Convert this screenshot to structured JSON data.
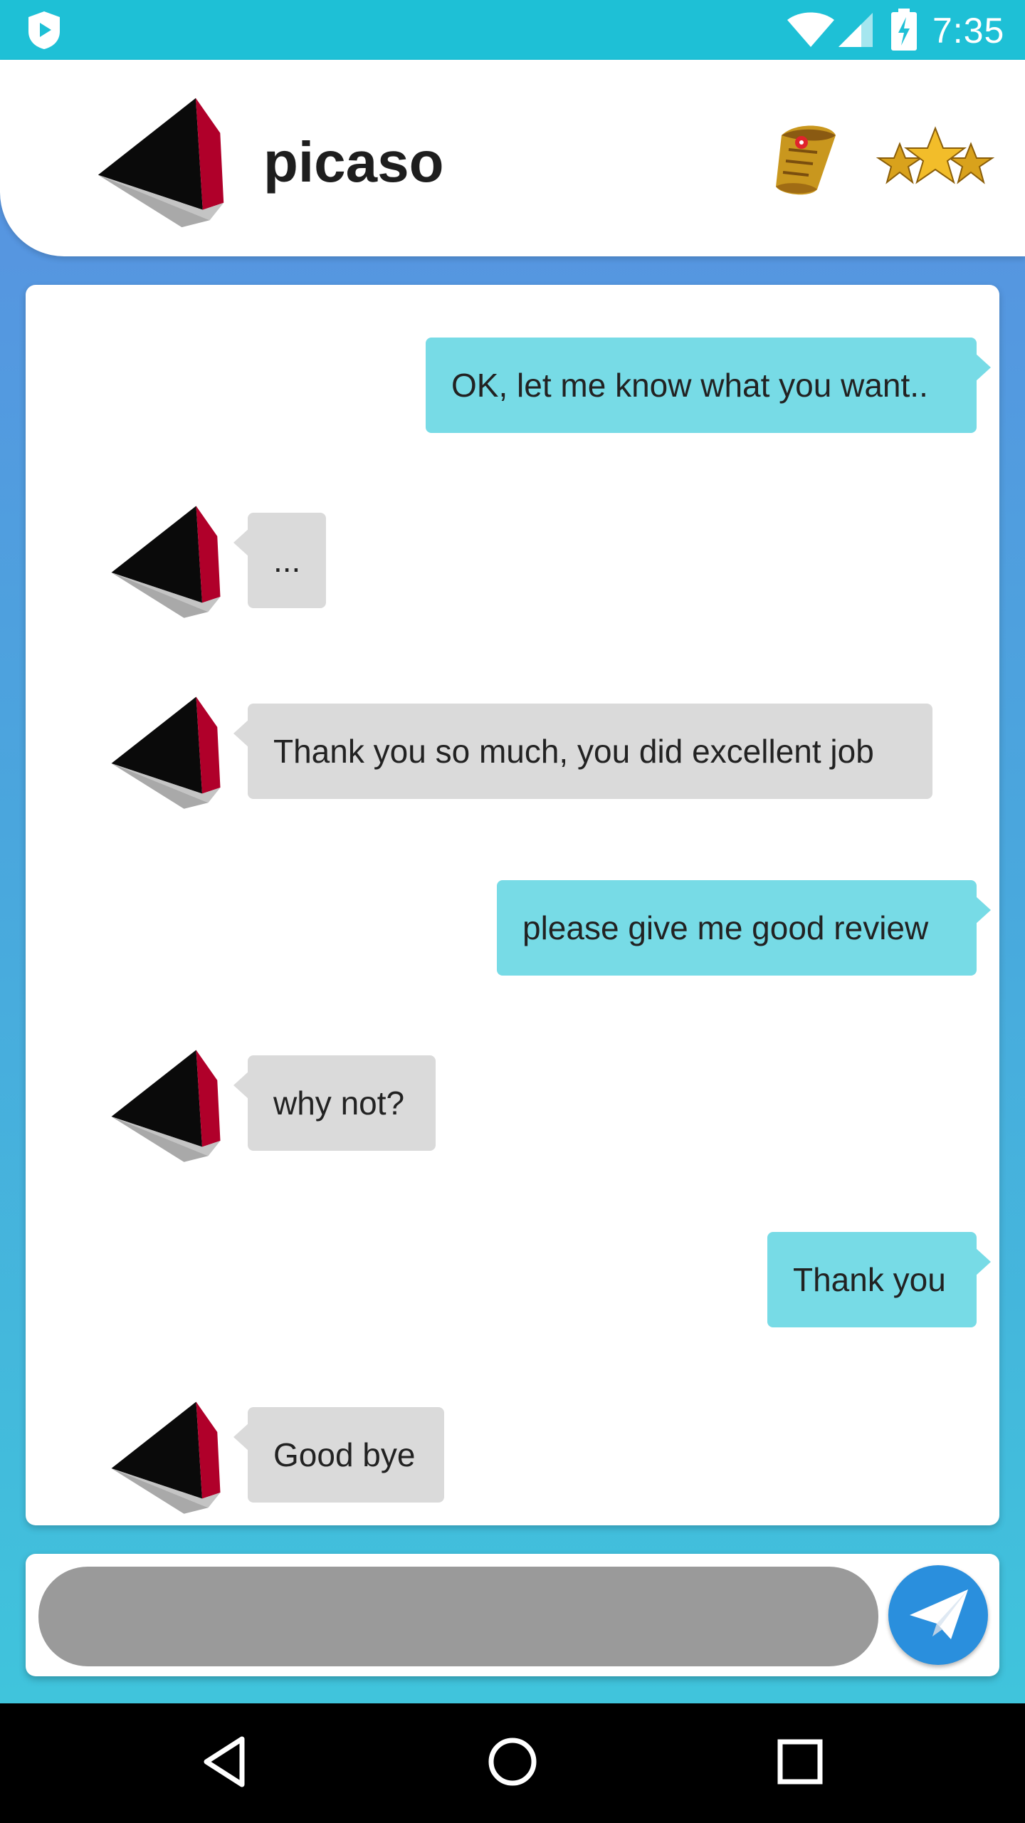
{
  "status_bar": {
    "time": "7:35",
    "icons": [
      "shield-icon",
      "wifi-icon",
      "signal-icon",
      "battery-charging-icon"
    ]
  },
  "header": {
    "title": "picaso",
    "icons": [
      "avatar-pyramid-icon",
      "scroll-map-icon",
      "three-stars-icon"
    ]
  },
  "messages": [
    {
      "sender": "me",
      "text": "OK, let me know what you want.."
    },
    {
      "sender": "other",
      "text": "..."
    },
    {
      "sender": "other",
      "text": "Thank you so much, you did excellent job"
    },
    {
      "sender": "me",
      "text": "please give me good review"
    },
    {
      "sender": "other",
      "text": "why not?"
    },
    {
      "sender": "me",
      "text": "Thank you"
    },
    {
      "sender": "other",
      "text": "Good bye"
    }
  ],
  "composer": {
    "placeholder": "",
    "send_icon": "paper-plane-icon"
  },
  "nav_bar": {
    "icons": [
      "back-icon",
      "home-icon",
      "recents-icon"
    ]
  },
  "colors": {
    "status_bar": "#1ec0d6",
    "sent_bubble": "#77dbe6",
    "received_bubble": "#dadada",
    "send_button": "#2a8fdd"
  }
}
